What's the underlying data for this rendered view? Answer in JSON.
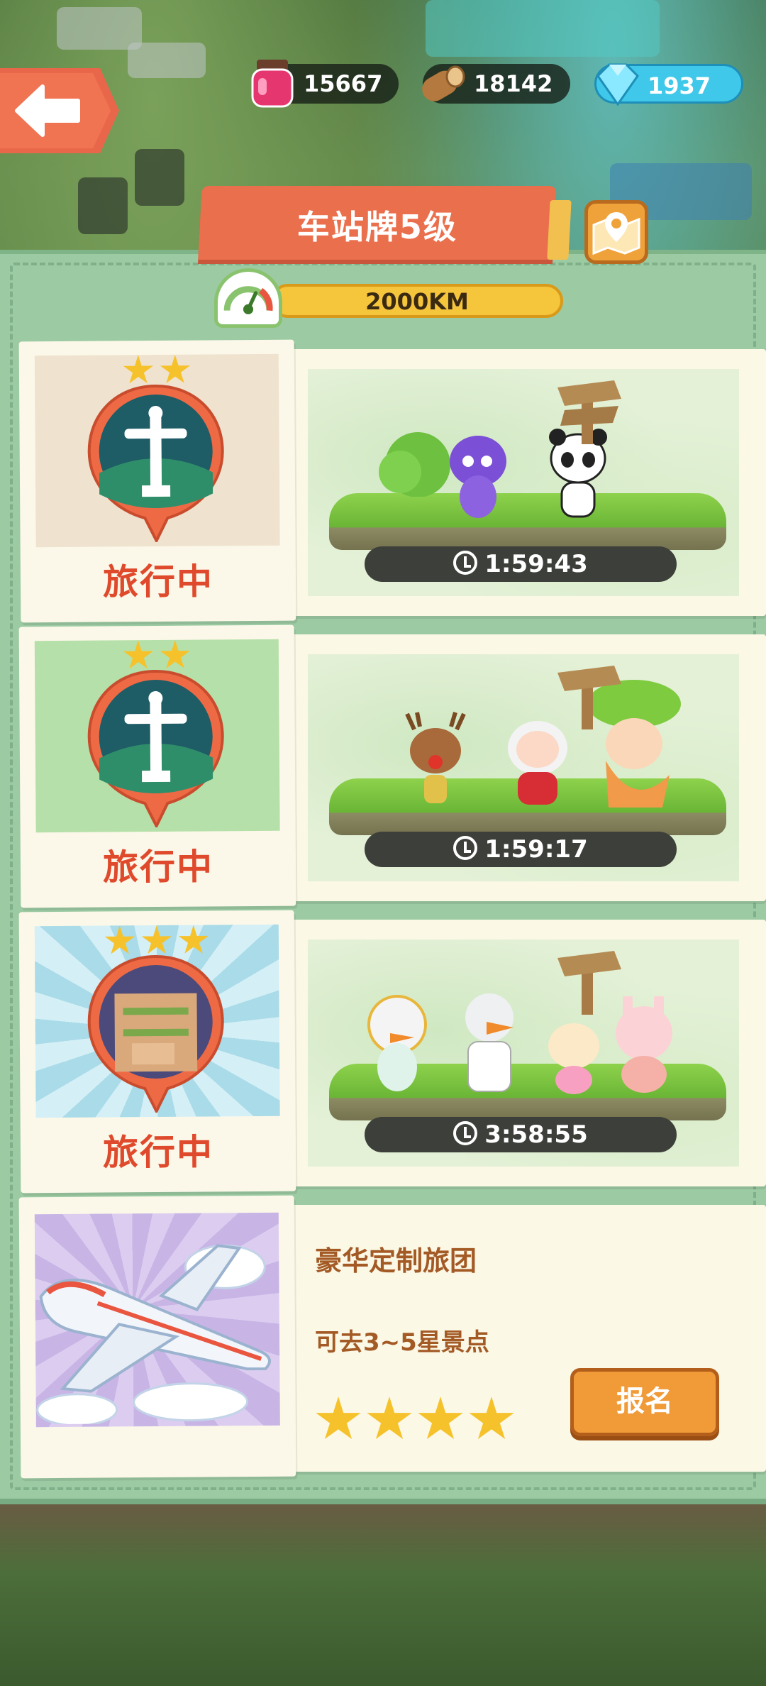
{
  "resources": {
    "jam": {
      "value": "15667",
      "icon": "jam-jar-icon"
    },
    "wood": {
      "value": "18142",
      "icon": "wood-log-icon"
    },
    "gems": {
      "value": "1937",
      "icon": "diamond-icon"
    }
  },
  "header": {
    "title": "车站牌5级"
  },
  "distance": {
    "label": "2000KM"
  },
  "trips": [
    {
      "status": "旅行中",
      "timer": "1:59:43",
      "stars": 2,
      "scene": "christ-statue",
      "photo_bg": "#efe3cf"
    },
    {
      "status": "旅行中",
      "timer": "1:59:17",
      "stars": 2,
      "scene": "christ-statue",
      "photo_bg": "#b6e0a9"
    },
    {
      "status": "旅行中",
      "timer": "3:58:55",
      "stars": 3,
      "scene": "hanging-gardens",
      "photo_bg": "#a9dbe8"
    }
  ],
  "tour": {
    "name": "豪华定制旅团",
    "desc": "可去3~5星景点",
    "stars": 4,
    "signup_label": "报名"
  },
  "colors": {
    "accent": "#ea6f4d",
    "panel": "#9ccaa2",
    "status_red": "#e04a2c",
    "tour_brown": "#a35a25",
    "button_orange": "#f09a38"
  }
}
